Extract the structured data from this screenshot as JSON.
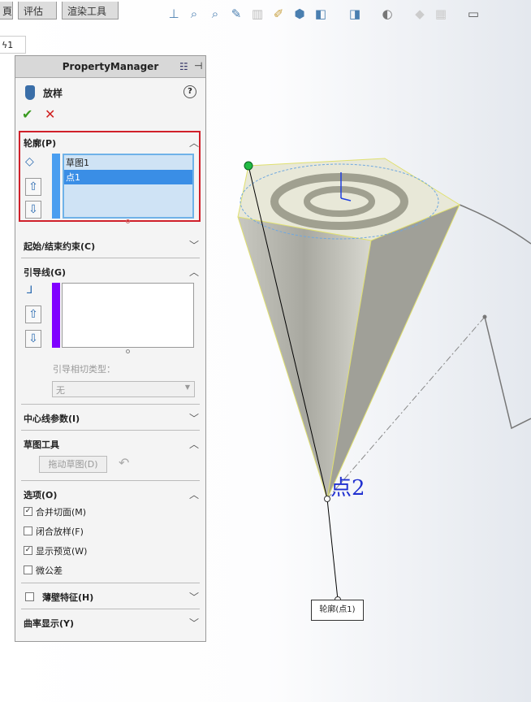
{
  "tabs": [
    "頁",
    "评估",
    "渲染工具"
  ],
  "doc_tab": "ϟ1",
  "panel": {
    "title": "PropertyManager",
    "feature_name": "放样",
    "sections": {
      "profiles": {
        "label": "轮廓(P)",
        "items": [
          "草图1",
          "点1"
        ],
        "selected": 1
      },
      "start_end": {
        "label": "起始/结束约束(C)"
      },
      "guides": {
        "label": "引导线(G)",
        "tangency_label": "引导相切类型：",
        "tangency_value": "无"
      },
      "centerline": {
        "label": "中心线参数(I)"
      },
      "sketch_tools": {
        "label": "草图工具",
        "drag_button": "拖动草图(D)"
      },
      "options": {
        "label": "选项(O)",
        "items": [
          {
            "label": "合并切面(M)",
            "checked": true
          },
          {
            "label": "闭合放样(F)",
            "checked": false
          },
          {
            "label": "显示预览(W)",
            "checked": true
          },
          {
            "label": "微公差",
            "checked": false
          }
        ]
      },
      "thin": {
        "label": "薄壁特征(H)",
        "checked": false
      },
      "curvature": {
        "label": "曲率显示(Y)"
      }
    }
  },
  "viewport": {
    "point_label": "点2",
    "callout": "轮廓(点1)"
  },
  "colors": {
    "accent": "#3399ff",
    "selection": "#3a8ee6",
    "guide": "#8000ff",
    "highlight_border": "#d0202a"
  }
}
